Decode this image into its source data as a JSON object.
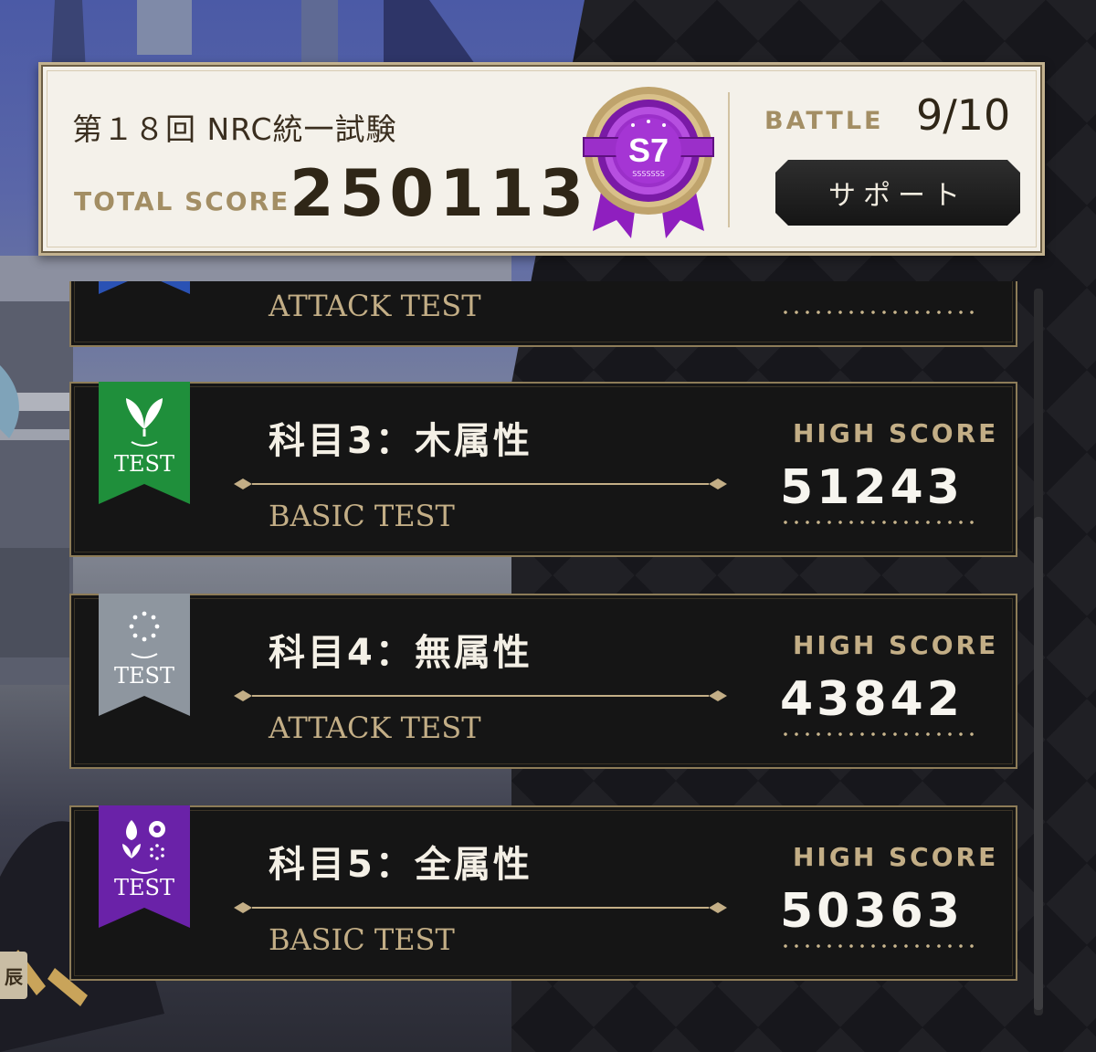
{
  "header": {
    "exam_title": "第１８回 NRC統一試験",
    "total_score_label": "TOTAL SCORE",
    "total_score_value": "250113",
    "rank": {
      "label": "S7",
      "sub": "SSSSSSS",
      "color": "#9b2fc9"
    },
    "battle_label": "BATTLE",
    "battle_value": "9/10",
    "support_button": "サポート"
  },
  "side_tag": "辰",
  "subjects": [
    {
      "name": "",
      "test_type": "ATTACK TEST",
      "high_score_label": "",
      "high_score": "",
      "ribbon_color": "#2a52b4",
      "ribbon_text": "",
      "icon": "partial-ribbon-icon"
    },
    {
      "name": "科目3：木属性",
      "test_type": "BASIC TEST",
      "high_score_label": "HIGH SCORE",
      "high_score": "51243",
      "ribbon_color": "#1f8f3b",
      "ribbon_text": "TEST",
      "icon": "leaf-icon"
    },
    {
      "name": "科目4：無属性",
      "test_type": "ATTACK TEST",
      "high_score_label": "HIGH SCORE",
      "high_score": "43842",
      "ribbon_color": "#8e969f",
      "ribbon_text": "TEST",
      "icon": "dotted-circle-icon"
    },
    {
      "name": "科目5：全属性",
      "test_type": "BASIC TEST",
      "high_score_label": "HIGH SCORE",
      "high_score": "50363",
      "ribbon_color": "#6a22a8",
      "ribbon_text": "TEST",
      "icon": "all-elements-icon"
    }
  ]
}
